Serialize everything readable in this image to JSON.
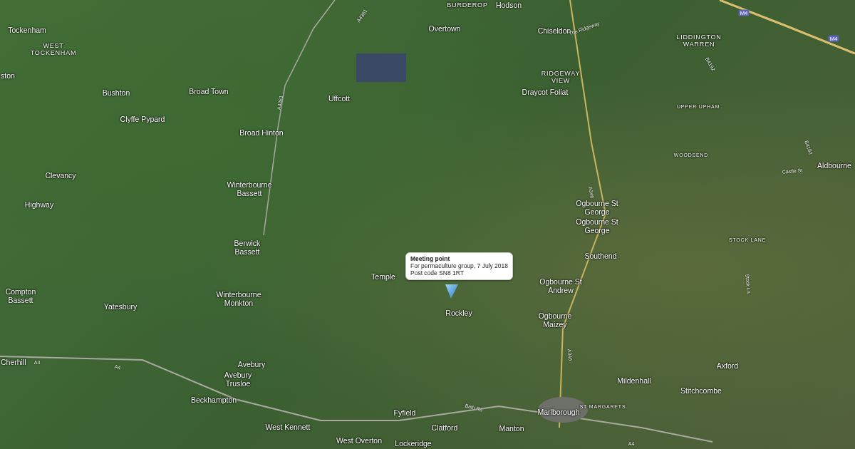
{
  "map": {
    "place_labels": [
      {
        "text": "Tockenham",
        "kind": "village"
      },
      {
        "text": "WEST TOCKENHAM",
        "kind": "locality"
      },
      {
        "text": "ston",
        "kind": "village"
      },
      {
        "text": "Bushton",
        "kind": "village"
      },
      {
        "text": "Broad Town",
        "kind": "village"
      },
      {
        "text": "Clyffe Pypard",
        "kind": "village"
      },
      {
        "text": "Broad Hinton",
        "kind": "village"
      },
      {
        "text": "Clevancy",
        "kind": "village"
      },
      {
        "text": "Winterbourne Bassett",
        "kind": "village"
      },
      {
        "text": "Highway",
        "kind": "village"
      },
      {
        "text": "BURDEROP",
        "kind": "locality"
      },
      {
        "text": "Hodson",
        "kind": "village"
      },
      {
        "text": "Overtown",
        "kind": "village"
      },
      {
        "text": "Chiseldon",
        "kind": "village"
      },
      {
        "text": "RIDGEWAY VIEW",
        "kind": "locality"
      },
      {
        "text": "Uffcott",
        "kind": "village"
      },
      {
        "text": "Draycot Foliat",
        "kind": "village"
      },
      {
        "text": "LIDDINGTON WARREN",
        "kind": "locality"
      },
      {
        "text": "UPPER UPHAM",
        "kind": "hamlet"
      },
      {
        "text": "WOODSEND",
        "kind": "hamlet"
      },
      {
        "text": "Aldbourne",
        "kind": "village"
      },
      {
        "text": "Ogbourne St George",
        "kind": "village"
      },
      {
        "text": "Ogbourne St George",
        "kind": "village"
      },
      {
        "text": "STOCK LANE",
        "kind": "hamlet"
      },
      {
        "text": "Southend",
        "kind": "village"
      },
      {
        "text": "Berwick Bassett",
        "kind": "village"
      },
      {
        "text": "Temple",
        "kind": "village"
      },
      {
        "text": "Compton Bassett",
        "kind": "village"
      },
      {
        "text": "Yatesbury",
        "kind": "village"
      },
      {
        "text": "Winterbourne Monkton",
        "kind": "village"
      },
      {
        "text": "Ogbourne St Andrew",
        "kind": "village"
      },
      {
        "text": "Rockley",
        "kind": "village"
      },
      {
        "text": "Ogbourne Maizey",
        "kind": "village"
      },
      {
        "text": "Cherhill",
        "kind": "village"
      },
      {
        "text": "Avebury",
        "kind": "village"
      },
      {
        "text": "Avebury Trusloe",
        "kind": "village"
      },
      {
        "text": "Axford",
        "kind": "village"
      },
      {
        "text": "Beckhampton",
        "kind": "village"
      },
      {
        "text": "Mildenhall",
        "kind": "village"
      },
      {
        "text": "Stitchcombe",
        "kind": "village"
      },
      {
        "text": "Marlborough",
        "kind": "village"
      },
      {
        "text": "ST MARGARETS",
        "kind": "hamlet"
      },
      {
        "text": "Fyfield",
        "kind": "village"
      },
      {
        "text": "West Kennett",
        "kind": "village"
      },
      {
        "text": "Clatford",
        "kind": "village"
      },
      {
        "text": "Manton",
        "kind": "village"
      },
      {
        "text": "West Overton",
        "kind": "village"
      },
      {
        "text": "Lockeridge",
        "kind": "village"
      }
    ],
    "road_labels": [
      {
        "text": "M4",
        "kind": "motorway"
      },
      {
        "text": "M4",
        "kind": "motorway"
      },
      {
        "text": "A4361",
        "kind": "road"
      },
      {
        "text": "A4361",
        "kind": "road"
      },
      {
        "text": "A346",
        "kind": "road"
      },
      {
        "text": "A346",
        "kind": "road"
      },
      {
        "text": "B4192",
        "kind": "road"
      },
      {
        "text": "B4192",
        "kind": "road"
      },
      {
        "text": "The Ridgeway",
        "kind": "road"
      },
      {
        "text": "Castle St",
        "kind": "road"
      },
      {
        "text": "Stock Ln",
        "kind": "road"
      },
      {
        "text": "A4",
        "kind": "road"
      },
      {
        "text": "A4",
        "kind": "road"
      },
      {
        "text": "A4",
        "kind": "road"
      },
      {
        "text": "Bath Rd",
        "kind": "road"
      }
    ],
    "info_window": {
      "title": "Meeting point",
      "lines": [
        "For permaculture group, 7 July 2018",
        "Post code SN8 1RT"
      ]
    }
  }
}
